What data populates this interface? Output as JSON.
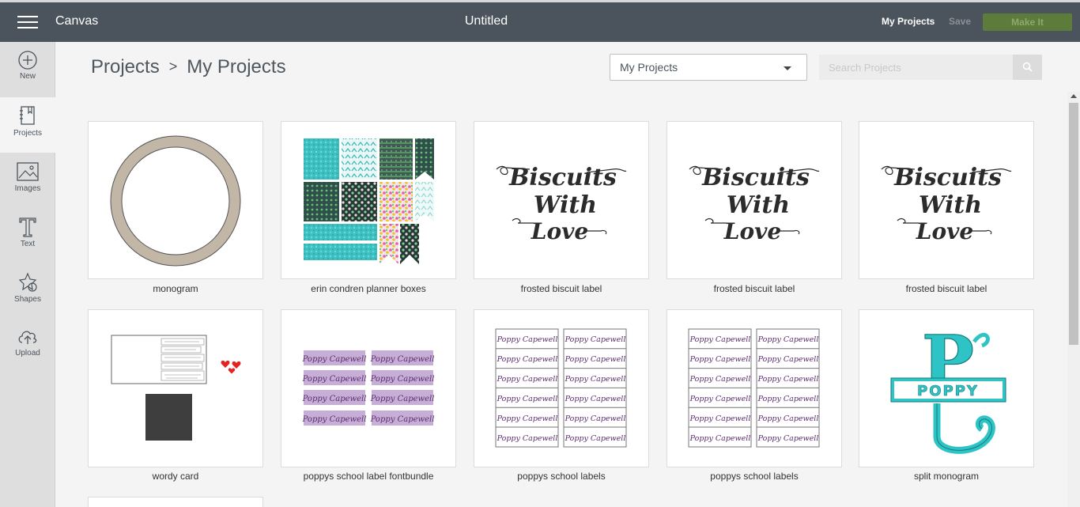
{
  "topbar": {
    "app_title": "Canvas",
    "doc_title": "Untitled",
    "my_projects": "My Projects",
    "save": "Save",
    "make_it": "Make It"
  },
  "sidebar": {
    "items": [
      {
        "label": "New",
        "icon": "plus-circle-icon"
      },
      {
        "label": "Projects",
        "icon": "projects-icon"
      },
      {
        "label": "Images",
        "icon": "image-icon"
      },
      {
        "label": "Text",
        "icon": "text-icon"
      },
      {
        "label": "Shapes",
        "icon": "shapes-icon"
      },
      {
        "label": "Upload",
        "icon": "cloud-upload-icon"
      }
    ]
  },
  "breadcrumb": {
    "root": "Projects",
    "separator": ">",
    "current": "My Projects"
  },
  "filter": {
    "selected": "My Projects"
  },
  "search": {
    "placeholder": "Search Projects"
  },
  "thumb_text": {
    "biscuit_line1": "Biscuits",
    "biscuit_line2": "With",
    "biscuit_line3": "Love",
    "poppy_label": "Poppy Capewell",
    "monogram_name": "POPPY",
    "monogram_letter": "P"
  },
  "projects": [
    {
      "name": "monogram"
    },
    {
      "name": "erin condren planner boxes"
    },
    {
      "name": "frosted biscuit label"
    },
    {
      "name": "frosted biscuit label"
    },
    {
      "name": "frosted biscuit label"
    },
    {
      "name": "wordy card"
    },
    {
      "name": "poppys school label fontbundle"
    },
    {
      "name": "poppys school labels"
    },
    {
      "name": "poppys school labels"
    },
    {
      "name": "split monogram"
    }
  ],
  "colors": {
    "topbar": "#4b545c",
    "make_it": "#5d7c3c",
    "monogram_ring": "#c2b7a7",
    "teal": "#2ec4c6",
    "lavender": "#c7aed6",
    "heart": "#e02424"
  }
}
